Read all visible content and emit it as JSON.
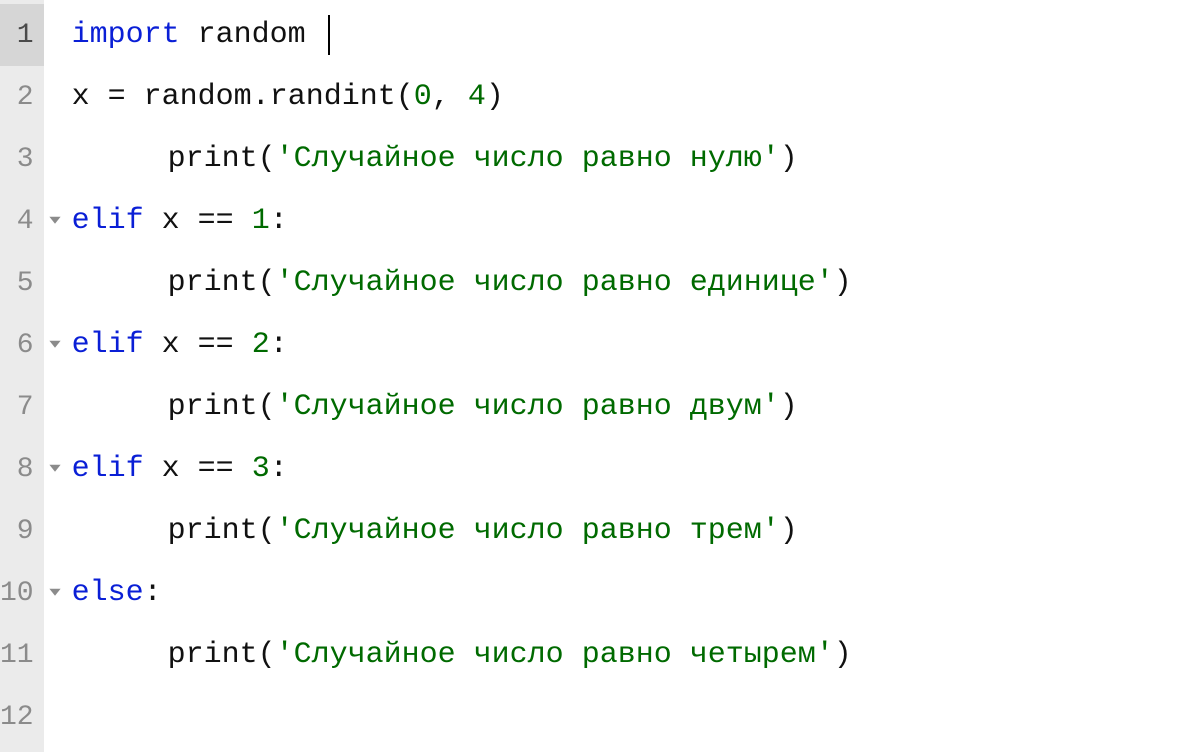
{
  "editor": {
    "active_line_index": 0,
    "gutter": [
      {
        "num": "1",
        "fold": false
      },
      {
        "num": "2",
        "fold": false
      },
      {
        "num": "3",
        "fold": false
      },
      {
        "num": "4",
        "fold": true
      },
      {
        "num": "5",
        "fold": false
      },
      {
        "num": "6",
        "fold": true
      },
      {
        "num": "7",
        "fold": false
      },
      {
        "num": "8",
        "fold": true
      },
      {
        "num": "9",
        "fold": false
      },
      {
        "num": "10",
        "fold": true
      },
      {
        "num": "11",
        "fold": false
      },
      {
        "num": "12",
        "fold": false
      }
    ],
    "tokens": {
      "kw_import": "import",
      "kw_elif": "elif",
      "kw_else": "else",
      "id_random": "random",
      "id_x": "x",
      "id_randint": "randint",
      "id_print": "print",
      "op_assign": "=",
      "op_eq": "==",
      "dot": ".",
      "lpar": "(",
      "rpar": ")",
      "comma": ",",
      "colon": ":",
      "num_0": "0",
      "num_1": "1",
      "num_2": "2",
      "num_3": "3",
      "num_4": "4",
      "str_zero": "'Случайное число равно нулю'",
      "str_one": "'Случайное число равно единице'",
      "str_two": "'Случайное число равно двум'",
      "str_three": "'Случайное число равно трем'",
      "str_four": "'Случайное число равно четырем'"
    }
  }
}
